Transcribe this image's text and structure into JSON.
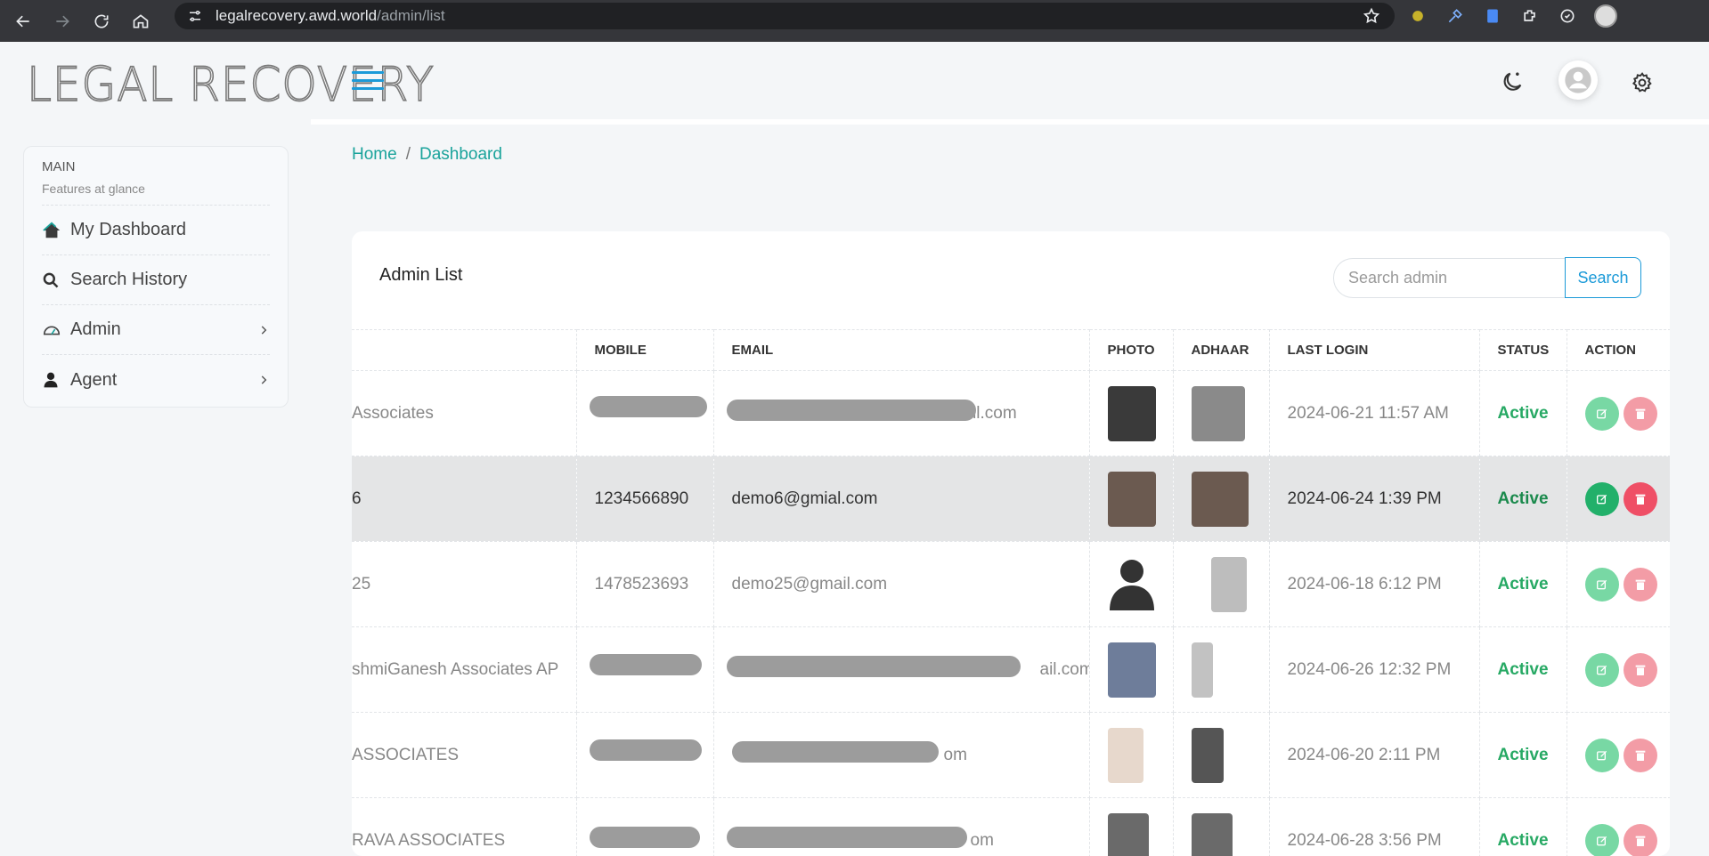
{
  "browser": {
    "url_host": "legalrecovery.awd.world",
    "url_path": "/admin/list"
  },
  "sidebar": {
    "logo": "LEGAL RECOVERY",
    "section_title": "MAIN",
    "section_subtitle": "Features at glance",
    "items": [
      {
        "label": "My Dashboard",
        "icon": "home-icon"
      },
      {
        "label": "Search History",
        "icon": "search-icon"
      },
      {
        "label": "Admin",
        "icon": "speedometer-icon"
      },
      {
        "label": "Agent",
        "icon": "person-icon"
      }
    ]
  },
  "breadcrumb": {
    "home": "Home",
    "separator": "/",
    "current": "Dashboard"
  },
  "card": {
    "title": "Admin List",
    "search_placeholder": "Search admin",
    "search_button": "Search"
  },
  "table": {
    "headers": [
      "",
      "MOBILE",
      "EMAIL",
      "PHOTO",
      "ADHAAR",
      "LAST LOGIN",
      "STATUS",
      "ACTION"
    ],
    "rows": [
      {
        "name": "Associates",
        "mobile": "",
        "email": "",
        "email_tail": "ail.com",
        "last_login": "2024-06-21 11:57 AM",
        "status": "Active"
      },
      {
        "name": "6",
        "mobile": "1234566890",
        "email": "demo6@gmial.com",
        "email_tail": "",
        "last_login": "2024-06-24 1:39 PM",
        "status": "Active"
      },
      {
        "name": "25",
        "mobile": "1478523693",
        "email": "demo25@gmail.com",
        "email_tail": "",
        "last_login": "2024-06-18 6:12 PM",
        "status": "Active"
      },
      {
        "name": "shmiGanesh Associates AP",
        "mobile": "",
        "email": "",
        "email_tail": "ail.com",
        "last_login": "2024-06-26 12:32 PM",
        "status": "Active"
      },
      {
        "name": "ASSOCIATES",
        "mobile": "",
        "email": "",
        "email_tail": "om",
        "last_login": "2024-06-20 2:11 PM",
        "status": "Active"
      },
      {
        "name": "RAVA ASSOCIATES",
        "mobile": "",
        "email": "",
        "email_tail": "om",
        "last_login": "2024-06-28 3:56 PM",
        "status": "Active"
      }
    ]
  },
  "colors": {
    "accent": "#1b9ad8",
    "teal": "#1aa39b",
    "status_active": "#27a964",
    "delete": "#ef4f66",
    "edit": "#22b06a"
  }
}
